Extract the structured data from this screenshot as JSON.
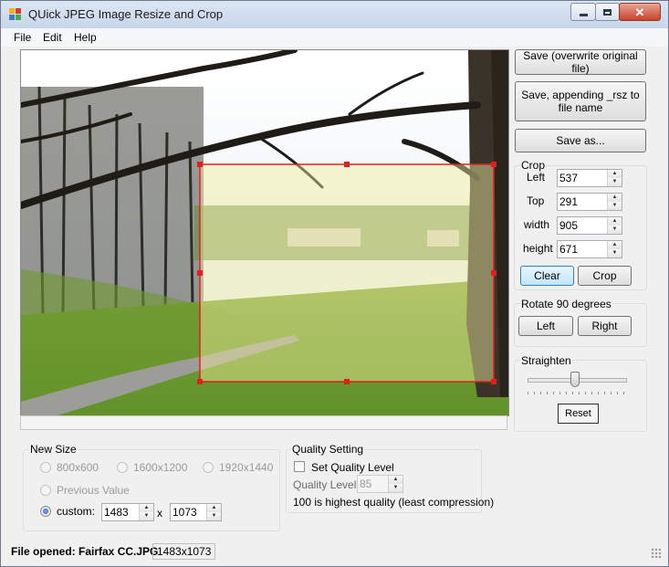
{
  "window": {
    "title": "QUick JPEG Image Resize and Crop"
  },
  "menu": [
    "File",
    "Edit",
    "Help"
  ],
  "save_buttons": {
    "overwrite": "Save (overwrite original file)",
    "append": "Save, appending _rsz to file name",
    "save_as": "Save as..."
  },
  "crop": {
    "label": "Crop",
    "left_label": "Left",
    "left": "537",
    "top_label": "Top",
    "top": "291",
    "width_label": "width",
    "width": "905",
    "height_label": "height",
    "height": "671",
    "clear": "Clear",
    "crop_button": "Crop"
  },
  "rotate": {
    "label": "Rotate 90 degrees",
    "left": "Left",
    "right": "Right"
  },
  "straighten": {
    "label": "Straighten",
    "reset": "Reset",
    "position": 0.48
  },
  "new_size": {
    "label": "New Size",
    "options": [
      "800x600",
      "1600x1200",
      "1920x1440"
    ],
    "previous": "Previous Value",
    "custom_label": "custom:",
    "custom_width": "1483",
    "times": "x",
    "custom_height": "1073",
    "selected": "custom"
  },
  "quality": {
    "label": "Quality Setting",
    "set_label": "Set Quality Level",
    "set_checked": false,
    "level_label": "Quality Level:",
    "level": "85",
    "note": "100 is highest quality (least compression)"
  },
  "status": {
    "file": "File opened: Fairfax CC.JPG",
    "dims": "1483x1073"
  },
  "colors": {
    "crop_rect": "#e0201c",
    "crop_fill": "#f3efa0",
    "accent": "#3b7bd4"
  }
}
